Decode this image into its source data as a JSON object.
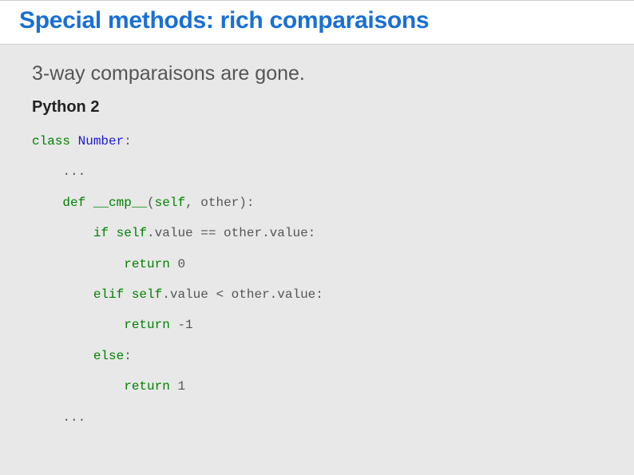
{
  "slide": {
    "title": "Special methods: rich comparaisons",
    "subtitle": "3-way comparaisons are gone.",
    "section_label": "Python 2",
    "code": {
      "tokens": [
        {
          "t": "class",
          "c": "tk-kw"
        },
        {
          "t": " ",
          "c": "tk-pn"
        },
        {
          "t": "Number",
          "c": "tk-cls"
        },
        {
          "t": ":",
          "c": "tk-pn"
        },
        {
          "t": "\n",
          "c": ""
        },
        {
          "t": "    ",
          "c": ""
        },
        {
          "t": "...",
          "c": "tk-ell"
        },
        {
          "t": "\n",
          "c": ""
        },
        {
          "t": "    ",
          "c": ""
        },
        {
          "t": "def",
          "c": "tk-kw"
        },
        {
          "t": " ",
          "c": "tk-pn"
        },
        {
          "t": "__cmp__",
          "c": "tk-builtin"
        },
        {
          "t": "(",
          "c": "tk-pn"
        },
        {
          "t": "self",
          "c": "tk-self"
        },
        {
          "t": ", other):",
          "c": "tk-pn"
        },
        {
          "t": "\n",
          "c": ""
        },
        {
          "t": "        ",
          "c": ""
        },
        {
          "t": "if",
          "c": "tk-kw"
        },
        {
          "t": " ",
          "c": "tk-pn"
        },
        {
          "t": "self",
          "c": "tk-self"
        },
        {
          "t": ".value ",
          "c": "tk-pn"
        },
        {
          "t": "==",
          "c": "tk-op"
        },
        {
          "t": " other.value:",
          "c": "tk-pn"
        },
        {
          "t": "\n",
          "c": ""
        },
        {
          "t": "            ",
          "c": ""
        },
        {
          "t": "return",
          "c": "tk-kw"
        },
        {
          "t": " ",
          "c": "tk-pn"
        },
        {
          "t": "0",
          "c": "tk-num"
        },
        {
          "t": "\n",
          "c": ""
        },
        {
          "t": "        ",
          "c": ""
        },
        {
          "t": "elif",
          "c": "tk-kw"
        },
        {
          "t": " ",
          "c": "tk-pn"
        },
        {
          "t": "self",
          "c": "tk-self"
        },
        {
          "t": ".value ",
          "c": "tk-pn"
        },
        {
          "t": "<",
          "c": "tk-op"
        },
        {
          "t": " other.value:",
          "c": "tk-pn"
        },
        {
          "t": "\n",
          "c": ""
        },
        {
          "t": "            ",
          "c": ""
        },
        {
          "t": "return",
          "c": "tk-kw"
        },
        {
          "t": " ",
          "c": "tk-pn"
        },
        {
          "t": "-",
          "c": "tk-op"
        },
        {
          "t": "1",
          "c": "tk-num"
        },
        {
          "t": "\n",
          "c": ""
        },
        {
          "t": "        ",
          "c": ""
        },
        {
          "t": "else",
          "c": "tk-kw"
        },
        {
          "t": ":",
          "c": "tk-pn"
        },
        {
          "t": "\n",
          "c": ""
        },
        {
          "t": "            ",
          "c": ""
        },
        {
          "t": "return",
          "c": "tk-kw"
        },
        {
          "t": " ",
          "c": "tk-pn"
        },
        {
          "t": "1",
          "c": "tk-num"
        },
        {
          "t": "\n",
          "c": ""
        },
        {
          "t": "    ",
          "c": ""
        },
        {
          "t": "...",
          "c": "tk-ell"
        }
      ]
    }
  }
}
